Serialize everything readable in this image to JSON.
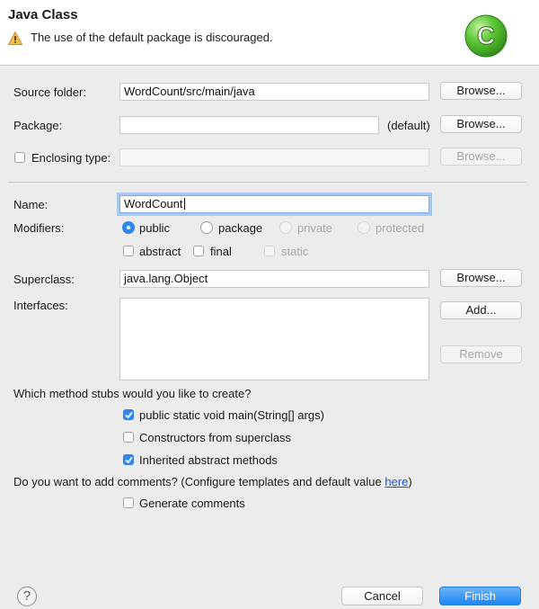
{
  "header": {
    "title": "Java Class",
    "message": "The use of the default package is discouraged.",
    "warning_icon": "warning-icon",
    "logo_icon": "java-class-c-icon",
    "logo_letter": "C"
  },
  "source_folder": {
    "label": "Source folder:",
    "value": "WordCount/src/main/java",
    "browse": "Browse..."
  },
  "package": {
    "label": "Package:",
    "value": "",
    "suffix": "(default)",
    "browse": "Browse..."
  },
  "enclosing_type": {
    "label": "Enclosing type:",
    "value": "",
    "browse": "Browse..."
  },
  "name": {
    "label": "Name:",
    "value": "WordCount"
  },
  "modifiers": {
    "label": "Modifiers:",
    "public": "public",
    "package": "package",
    "private": "private",
    "protected": "protected",
    "abstract": "abstract",
    "final": "final",
    "static": "static",
    "selected": "public"
  },
  "superclass": {
    "label": "Superclass:",
    "value": "java.lang.Object",
    "browse": "Browse..."
  },
  "interfaces": {
    "label": "Interfaces:",
    "add": "Add...",
    "remove": "Remove"
  },
  "stubs": {
    "question": "Which method stubs would you like to create?",
    "main": "public static void main(String[] args)",
    "constructors": "Constructors from superclass",
    "inherited": "Inherited abstract methods",
    "checked": {
      "main": true,
      "constructors": false,
      "inherited": true
    }
  },
  "comments": {
    "question": "Do you want to add comments? (Configure templates and default value ",
    "link": "here",
    "closing": ")",
    "generate": "Generate comments"
  },
  "footer": {
    "help": "?",
    "cancel": "Cancel",
    "finish": "Finish"
  },
  "colors": {
    "accent": "#2f8af7",
    "finish": "#1b86f5",
    "link": "#1a52d6",
    "logo": "#4cbf2a"
  }
}
